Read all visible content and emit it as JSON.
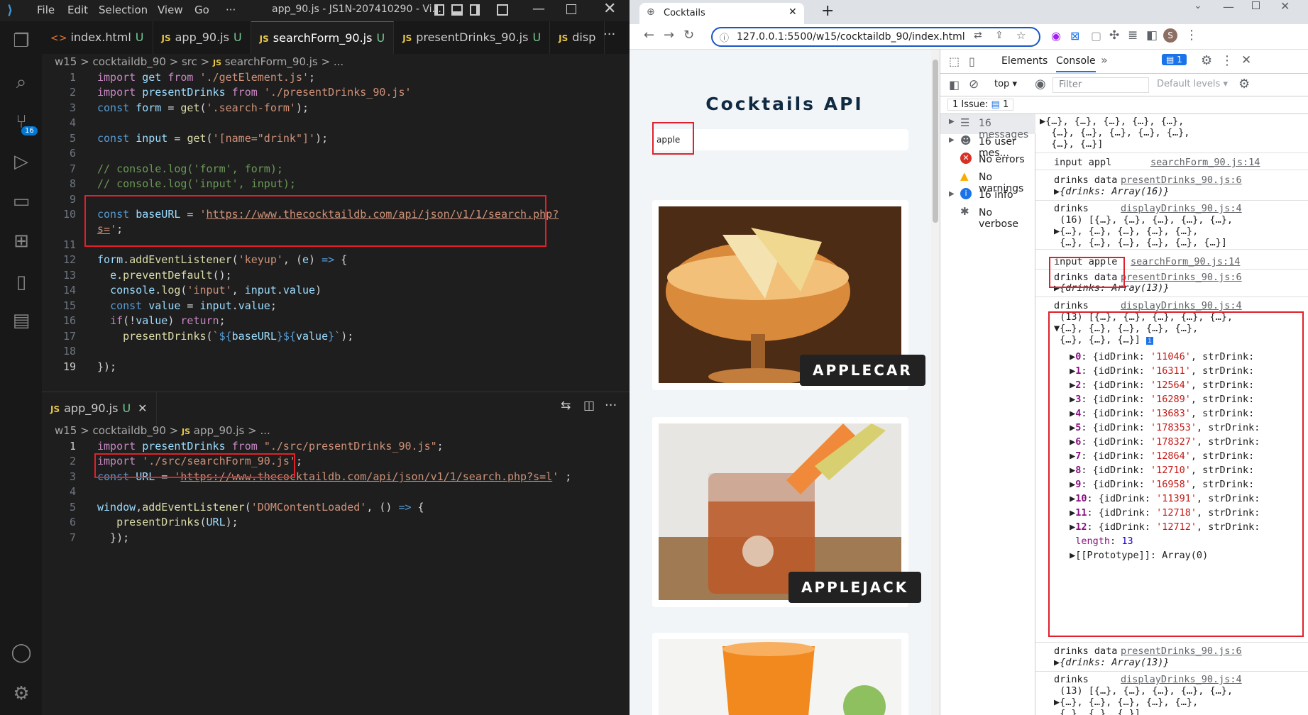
{
  "vscode": {
    "menu": [
      "File",
      "Edit",
      "Selection",
      "View",
      "Go",
      "···"
    ],
    "title": "app_90.js - JS1N-207410290 - Vi...",
    "tabs": [
      {
        "label": "index.html",
        "u": "U",
        "type": "html"
      },
      {
        "label": "app_90.js",
        "u": "U",
        "type": "js"
      },
      {
        "label": "searchForm_90.js",
        "u": "U",
        "type": "js"
      },
      {
        "label": "presentDrinks_90.js",
        "u": "U",
        "type": "js"
      },
      {
        "label": "disp",
        "u": "",
        "type": "js"
      }
    ],
    "badge": "16",
    "breadcrumb1": [
      "w15",
      "cocktaildb_90",
      "src",
      "searchForm_90.js",
      "..."
    ],
    "breadcrumb2": [
      "w15",
      "cocktaildb_90",
      "app_90.js",
      "..."
    ],
    "pane2_tab": {
      "label": "app_90.js",
      "u": "U"
    }
  },
  "browser": {
    "tab_title": "Cocktails",
    "url": "127.0.0.1:5500/w15/cocktaildb_90/index.html",
    "profile": "S",
    "page": {
      "heading": "Cocktails API",
      "input_value": "apple",
      "cards": [
        "APPLECAR",
        "APPLEJACK"
      ]
    },
    "devtools": {
      "tabs": [
        "Elements",
        "Console"
      ],
      "issues_badge": "1",
      "context": "top",
      "filter_placeholder": "Filter",
      "levels": "Default levels",
      "issue_bar": "1 Issue:",
      "issue_count": "1",
      "sidebar": [
        {
          "label": "16 messages",
          "icon": "list"
        },
        {
          "label": "16 user mes...",
          "icon": "user"
        },
        {
          "label": "No errors",
          "icon": "error"
        },
        {
          "label": "No warnings",
          "icon": "warning"
        },
        {
          "label": "16 info",
          "icon": "info"
        },
        {
          "label": "No verbose",
          "icon": "bug"
        }
      ]
    }
  }
}
